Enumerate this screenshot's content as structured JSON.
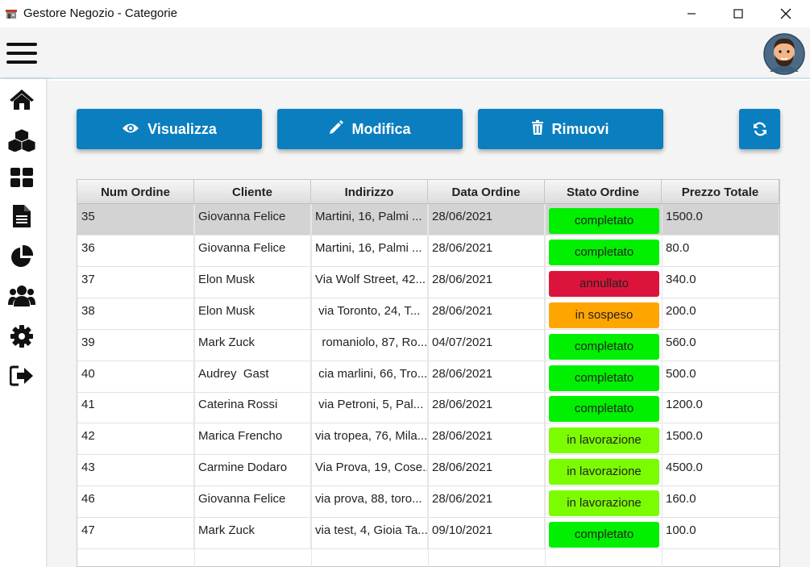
{
  "window": {
    "title": "Gestore Negozio - Categorie",
    "controls": [
      "minimize-icon",
      "maximize-icon",
      "close-icon"
    ]
  },
  "topbar": {
    "menu_icon": "hamburger-menu-icon",
    "avatar_icon": "user-avatar"
  },
  "sidebar": {
    "items": [
      {
        "icon": "home-icon"
      },
      {
        "icon": "cubes-icon"
      },
      {
        "icon": "dashboard-grid-icon"
      },
      {
        "icon": "document-icon"
      },
      {
        "icon": "pie-chart-icon"
      },
      {
        "icon": "users-icon"
      },
      {
        "icon": "gear-icon"
      },
      {
        "icon": "sign-out-icon"
      }
    ]
  },
  "toolbar": {
    "view_label": "Visualizza",
    "edit_label": "Modifica",
    "remove_label": "Rimuovi",
    "refresh_icon": "refresh-icon"
  },
  "colors": {
    "accent": "#0b7ec0",
    "completato": "#00f000",
    "annullato": "#dc143c",
    "in_sospeso": "#ffa500",
    "in_lavorazione": "#7cfc00"
  },
  "table": {
    "headers": [
      "Num Ordine",
      "Cliente",
      "Indirizzo",
      "Data Ordine",
      "Stato Ordine",
      "Prezzo Totale"
    ],
    "rows": [
      {
        "num": "35",
        "cliente": "Giovanna Felice",
        "indirizzo": "Martini, 16, Palmi ...",
        "data": "28/06/2021",
        "stato": "completato",
        "prezzo": "1500.0"
      },
      {
        "num": "36",
        "cliente": "Giovanna Felice",
        "indirizzo": "Martini, 16, Palmi ...",
        "data": "28/06/2021",
        "stato": "completato",
        "prezzo": "80.0"
      },
      {
        "num": "37",
        "cliente": "Elon Musk",
        "indirizzo": "Via Wolf Street, 42...",
        "data": "28/06/2021",
        "stato": "annullato",
        "prezzo": "340.0"
      },
      {
        "num": "38",
        "cliente": "Elon Musk",
        "indirizzo": " via Toronto, 24, T...",
        "data": "28/06/2021",
        "stato": "in sospeso",
        "prezzo": "200.0"
      },
      {
        "num": "39",
        "cliente": "Mark Zuck",
        "indirizzo": "  romaniolo, 87, Ro...",
        "data": "04/07/2021",
        "stato": "completato",
        "prezzo": "560.0"
      },
      {
        "num": "40",
        "cliente": "Audrey  Gast",
        "indirizzo": " cia marlini, 66, Tro...",
        "data": "28/06/2021",
        "stato": "completato",
        "prezzo": "500.0"
      },
      {
        "num": "41",
        "cliente": "Caterina Rossi",
        "indirizzo": " via Petroni, 5, Pal...",
        "data": "28/06/2021",
        "stato": "completato",
        "prezzo": "1200.0"
      },
      {
        "num": "42",
        "cliente": "Marica Frencho",
        "indirizzo": "via tropea, 76, Mila...",
        "data": "28/06/2021",
        "stato": "in lavorazione",
        "prezzo": "1500.0"
      },
      {
        "num": "43",
        "cliente": "Carmine Dodaro",
        "indirizzo": "Via Prova, 19, Cose...",
        "data": "28/06/2021",
        "stato": "in lavorazione",
        "prezzo": "4500.0"
      },
      {
        "num": "46",
        "cliente": "Giovanna Felice",
        "indirizzo": "via prova, 88, toro...",
        "data": "28/06/2021",
        "stato": "in lavorazione",
        "prezzo": "160.0"
      },
      {
        "num": "47",
        "cliente": "Mark Zuck",
        "indirizzo": "via test, 4, Gioia Ta...",
        "data": "09/10/2021",
        "stato": "completato",
        "prezzo": "100.0"
      }
    ]
  }
}
